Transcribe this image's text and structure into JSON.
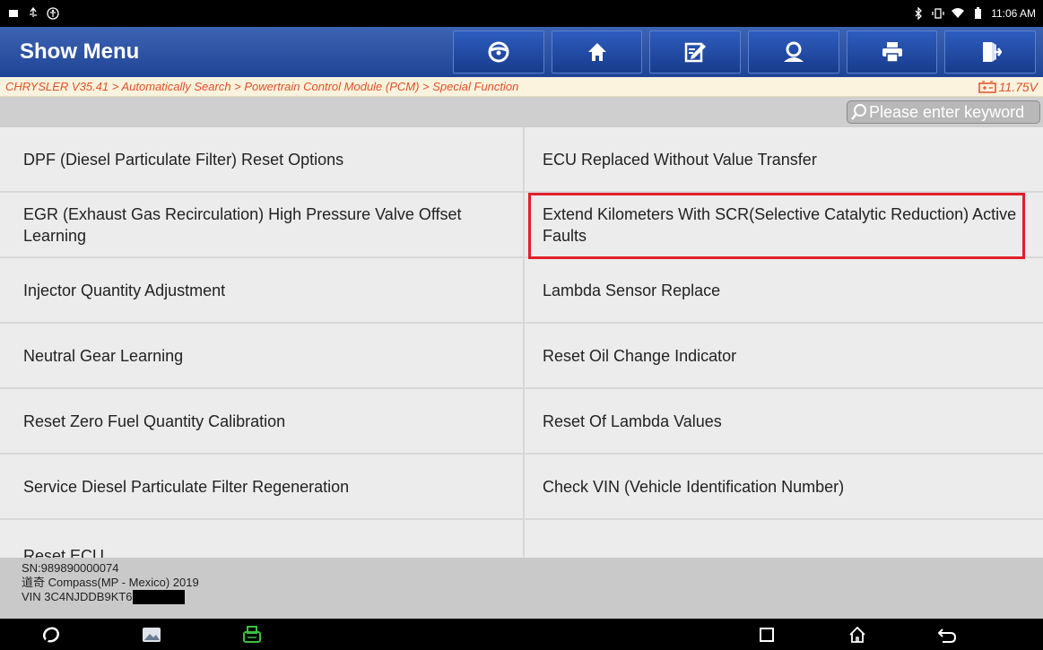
{
  "statusbar": {
    "time": "11:06 AM"
  },
  "header": {
    "title": "Show Menu",
    "toolbar": [
      {
        "icon": "steering-wheel-icon"
      },
      {
        "icon": "home-icon"
      },
      {
        "icon": "edit-note-icon"
      },
      {
        "icon": "support-user-icon"
      },
      {
        "icon": "print-icon"
      },
      {
        "icon": "exit-icon"
      }
    ]
  },
  "breadcrumb": {
    "path": "CHRYSLER V35.41 > Automatically Search > Powertrain Control Module (PCM) > Special Function",
    "voltage": "11.75V"
  },
  "search": {
    "placeholder": "Please enter keyword"
  },
  "menu": {
    "items": [
      "DPF (Diesel Particulate Filter) Reset Options",
      "ECU Replaced Without Value Transfer",
      "EGR (Exhaust Gas Recirculation) High Pressure Valve Offset Learning",
      "Extend Kilometers With SCR(Selective Catalytic Reduction) Active Faults",
      "Injector Quantity Adjustment",
      "Lambda Sensor Replace",
      "Neutral Gear Learning",
      "Reset Oil Change Indicator",
      "Reset Zero Fuel Quantity Calibration",
      "Reset Of Lambda Values",
      "Service Diesel Particulate Filter Regeneration",
      "Check VIN (Vehicle Identification Number)",
      "Reset ECU"
    ],
    "highlighted_item": "Extend Kilometers With SCR(Selective Catalytic Reduction) Active Faults"
  },
  "footer": {
    "sn": "SN:989890000074",
    "vehicle": "道奇 Compass(MP - Mexico) 2019",
    "vin": "VIN 3C4NJDDB9KT6"
  },
  "colors": {
    "header_blue": "#2a52a8",
    "breadcrumb_text": "#e0512a",
    "highlight_red": "#e01f2a"
  }
}
